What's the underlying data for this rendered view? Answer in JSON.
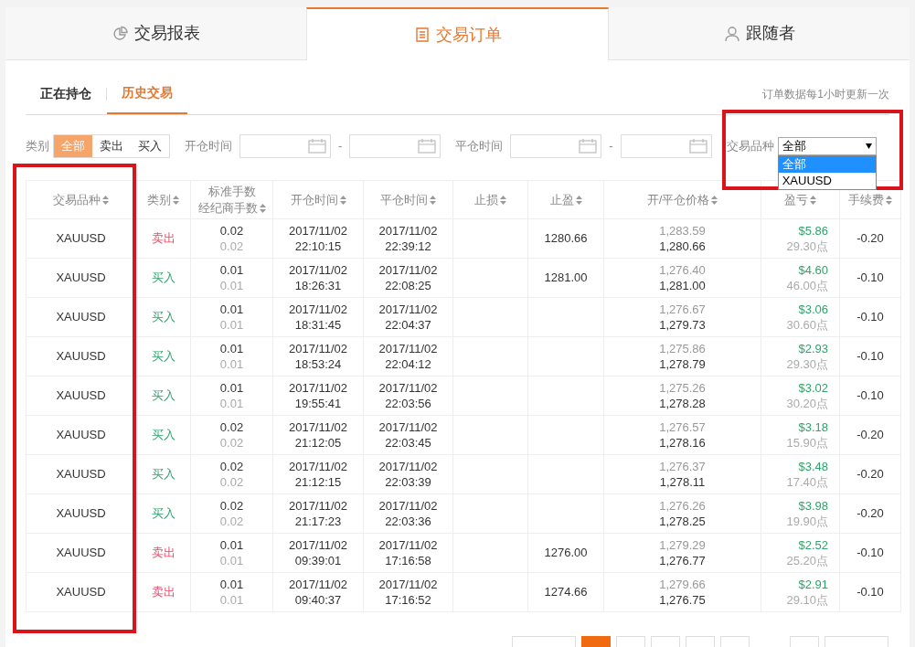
{
  "tabs": [
    {
      "label": "交易报表",
      "selected": false
    },
    {
      "label": "交易订单",
      "selected": true
    },
    {
      "label": "跟随者",
      "selected": false
    }
  ],
  "subtabs": [
    {
      "label": "正在持仓",
      "selected": false
    },
    {
      "label": "历史交易",
      "selected": true
    }
  ],
  "update_note": "订单数据每1小时更新一次",
  "filters": {
    "type_label": "类别",
    "type_options": [
      {
        "label": "全部",
        "selected": true
      },
      {
        "label": "卖出",
        "selected": false
      },
      {
        "label": "买入",
        "selected": false
      }
    ],
    "open_time_label": "开仓时间",
    "close_time_label": "平仓时间",
    "range_separator": "-",
    "symbol_label": "交易品种",
    "symbol_select": {
      "value": "全部",
      "expanded": true,
      "options": [
        {
          "label": "全部",
          "selected": true
        },
        {
          "label": "XAUUSD",
          "selected": false
        }
      ]
    }
  },
  "columns": [
    {
      "label": "交易品种"
    },
    {
      "label": "类别"
    },
    {
      "label": "标准手数",
      "sublabel": "经纪商手数"
    },
    {
      "label": "开仓时间"
    },
    {
      "label": "平仓时间"
    },
    {
      "label": "止损"
    },
    {
      "label": "止盈"
    },
    {
      "label": "开/平仓价格"
    },
    {
      "label": "盈亏"
    },
    {
      "label": "手续费"
    }
  ],
  "rows": [
    {
      "symbol": "XAUUSD",
      "side": {
        "label": "卖出",
        "kind": "sell"
      },
      "lots": "0.02",
      "broker_lots": "0.02",
      "open_date": "2017/11/02",
      "open_time": "22:10:15",
      "close_date": "2017/11/02",
      "close_time": "22:39:12",
      "take_profit": "1280.66",
      "open_price": "1,283.59",
      "close_price": "1,280.66",
      "profit": "$5.86",
      "points": "29.30点",
      "fee": "-0.20"
    },
    {
      "symbol": "XAUUSD",
      "side": {
        "label": "买入",
        "kind": "buy"
      },
      "lots": "0.01",
      "broker_lots": "0.01",
      "open_date": "2017/11/02",
      "open_time": "18:26:31",
      "close_date": "2017/11/02",
      "close_time": "22:08:25",
      "take_profit": "1281.00",
      "open_price": "1,276.40",
      "close_price": "1,281.00",
      "profit": "$4.60",
      "points": "46.00点",
      "fee": "-0.10"
    },
    {
      "symbol": "XAUUSD",
      "side": {
        "label": "买入",
        "kind": "buy"
      },
      "lots": "0.01",
      "broker_lots": "0.01",
      "open_date": "2017/11/02",
      "open_time": "18:31:45",
      "close_date": "2017/11/02",
      "close_time": "22:04:37",
      "open_price": "1,276.67",
      "close_price": "1,279.73",
      "profit": "$3.06",
      "points": "30.60点",
      "fee": "-0.10"
    },
    {
      "symbol": "XAUUSD",
      "side": {
        "label": "买入",
        "kind": "buy"
      },
      "lots": "0.01",
      "broker_lots": "0.01",
      "open_date": "2017/11/02",
      "open_time": "18:53:24",
      "close_date": "2017/11/02",
      "close_time": "22:04:12",
      "open_price": "1,275.86",
      "close_price": "1,278.79",
      "profit": "$2.93",
      "points": "29.30点",
      "fee": "-0.10"
    },
    {
      "symbol": "XAUUSD",
      "side": {
        "label": "买入",
        "kind": "buy"
      },
      "lots": "0.01",
      "broker_lots": "0.01",
      "open_date": "2017/11/02",
      "open_time": "19:55:41",
      "close_date": "2017/11/02",
      "close_time": "22:03:56",
      "open_price": "1,275.26",
      "close_price": "1,278.28",
      "profit": "$3.02",
      "points": "30.20点",
      "fee": "-0.10"
    },
    {
      "symbol": "XAUUSD",
      "side": {
        "label": "买入",
        "kind": "buy"
      },
      "lots": "0.02",
      "broker_lots": "0.02",
      "open_date": "2017/11/02",
      "open_time": "21:12:05",
      "close_date": "2017/11/02",
      "close_time": "22:03:45",
      "open_price": "1,276.57",
      "close_price": "1,278.16",
      "profit": "$3.18",
      "points": "15.90点",
      "fee": "-0.20"
    },
    {
      "symbol": "XAUUSD",
      "side": {
        "label": "买入",
        "kind": "buy"
      },
      "lots": "0.02",
      "broker_lots": "0.02",
      "open_date": "2017/11/02",
      "open_time": "21:12:15",
      "close_date": "2017/11/02",
      "close_time": "22:03:39",
      "open_price": "1,276.37",
      "close_price": "1,278.11",
      "profit": "$3.48",
      "points": "17.40点",
      "fee": "-0.20"
    },
    {
      "symbol": "XAUUSD",
      "side": {
        "label": "买入",
        "kind": "buy"
      },
      "lots": "0.02",
      "broker_lots": "0.02",
      "open_date": "2017/11/02",
      "open_time": "21:17:23",
      "close_date": "2017/11/02",
      "close_time": "22:03:36",
      "open_price": "1,276.26",
      "close_price": "1,278.25",
      "profit": "$3.98",
      "points": "19.90点",
      "fee": "-0.20"
    },
    {
      "symbol": "XAUUSD",
      "side": {
        "label": "卖出",
        "kind": "sell"
      },
      "lots": "0.01",
      "broker_lots": "0.01",
      "open_date": "2017/11/02",
      "open_time": "09:39:01",
      "close_date": "2017/11/02",
      "close_time": "17:16:58",
      "take_profit": "1276.00",
      "open_price": "1,279.29",
      "close_price": "1,276.77",
      "profit": "$2.52",
      "points": "25.20点",
      "fee": "-0.10"
    },
    {
      "symbol": "XAUUSD",
      "side": {
        "label": "卖出",
        "kind": "sell"
      },
      "lots": "0.01",
      "broker_lots": "0.01",
      "open_date": "2017/11/02",
      "open_time": "09:40:37",
      "close_date": "2017/11/02",
      "close_time": "17:16:52",
      "take_profit": "1274.66",
      "open_price": "1,279.66",
      "close_price": "1,276.75",
      "profit": "$2.91",
      "points": "29.10点",
      "fee": "-0.10"
    }
  ],
  "pagination": [
    {
      "selected": false
    },
    {
      "selected": true
    },
    {
      "selected": false
    },
    {
      "selected": false
    },
    {
      "selected": false
    },
    {
      "selected": false
    },
    {
      "selected": false
    },
    {
      "selected": false
    }
  ]
}
